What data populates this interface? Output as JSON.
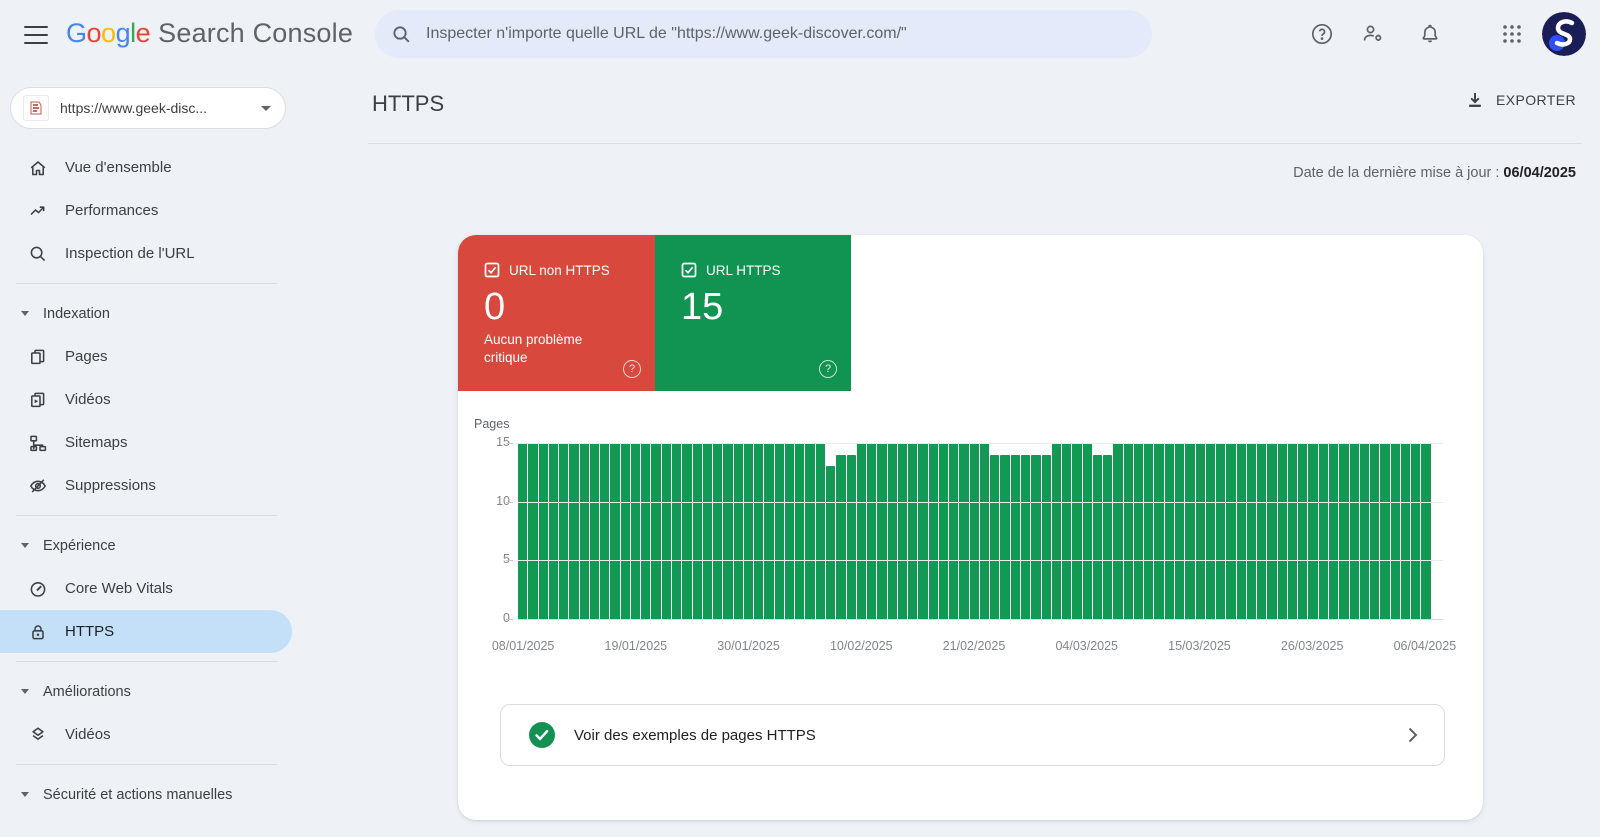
{
  "topbar": {
    "logo_letters": [
      {
        "ch": "G",
        "color": "#4285f4"
      },
      {
        "ch": "o",
        "color": "#ea4335"
      },
      {
        "ch": "o",
        "color": "#fbbc05"
      },
      {
        "ch": "g",
        "color": "#4285f4"
      },
      {
        "ch": "l",
        "color": "#34a853"
      },
      {
        "ch": "e",
        "color": "#ea4335"
      }
    ],
    "logo_suffix": "Search Console",
    "search_placeholder": "Inspecter n'importe quelle URL de \"https://www.geek-discover.com/\""
  },
  "property": {
    "name": "https://www.geek-disc..."
  },
  "sidebar": {
    "items": [
      {
        "type": "item",
        "id": "overview",
        "icon": "home",
        "label": "Vue d'ensemble"
      },
      {
        "type": "item",
        "id": "performances",
        "icon": "performance",
        "label": "Performances"
      },
      {
        "type": "item",
        "id": "url-inspection",
        "icon": "inspect",
        "label": "Inspection de l'URL"
      },
      {
        "type": "divider"
      },
      {
        "type": "section",
        "id": "indexation",
        "label": "Indexation"
      },
      {
        "type": "item",
        "id": "pages",
        "icon": "pages",
        "label": "Pages"
      },
      {
        "type": "item",
        "id": "videos-indexation",
        "icon": "videos",
        "label": "Vidéos"
      },
      {
        "type": "item",
        "id": "sitemaps",
        "icon": "sitemaps",
        "label": "Sitemaps"
      },
      {
        "type": "item",
        "id": "removals",
        "icon": "eye-off",
        "label": "Suppressions"
      },
      {
        "type": "divider"
      },
      {
        "type": "section",
        "id": "experience",
        "label": "Expérience"
      },
      {
        "type": "item",
        "id": "core-web-vitals",
        "icon": "gauge",
        "label": "Core Web Vitals"
      },
      {
        "type": "item",
        "id": "https",
        "icon": "lock",
        "label": "HTTPS",
        "selected": true
      },
      {
        "type": "divider"
      },
      {
        "type": "section",
        "id": "enhancements",
        "label": "Améliorations"
      },
      {
        "type": "item",
        "id": "videos-enhancement",
        "icon": "layers",
        "label": "Vidéos"
      },
      {
        "type": "divider"
      },
      {
        "type": "section",
        "id": "security",
        "label": "Sécurité et actions manuelles"
      }
    ]
  },
  "header": {
    "title": "HTTPS",
    "export_label": "EXPORTER",
    "last_update_label": "Date de la dernière mise à jour :",
    "last_update_date": "06/04/2025"
  },
  "cards": [
    {
      "label": "URL non HTTPS",
      "value": "0",
      "sublabel": "Aucun problème critique",
      "color": "#d8483c"
    },
    {
      "label": "URL HTTPS",
      "value": "15",
      "sublabel": "",
      "color": "#119452"
    }
  ],
  "chart_data": {
    "type": "bar",
    "title": "",
    "ylabel": "Pages",
    "ylim": [
      0,
      15
    ],
    "y_ticks": [
      0,
      5,
      10,
      15
    ],
    "grid": true,
    "bar_color": "#129a54",
    "date_range": {
      "start": "08/01/2025",
      "end": "06/04/2025"
    },
    "x_tick_labels": [
      "08/01/2025",
      "19/01/2025",
      "30/01/2025",
      "10/02/2025",
      "21/02/2025",
      "04/03/2025",
      "15/03/2025",
      "26/03/2025",
      "06/04/2025"
    ],
    "series_name": "URL HTTPS (Pages)",
    "values": [
      15,
      15,
      15,
      15,
      15,
      15,
      15,
      15,
      15,
      15,
      15,
      15,
      15,
      15,
      15,
      15,
      15,
      15,
      15,
      15,
      15,
      15,
      15,
      15,
      15,
      15,
      15,
      15,
      15,
      15,
      13,
      14,
      14,
      15,
      15,
      15,
      15,
      15,
      15,
      15,
      15,
      15,
      15,
      15,
      15,
      15,
      14,
      14,
      14,
      14,
      14,
      14,
      15,
      15,
      15,
      15,
      14,
      14,
      15,
      15,
      15,
      15,
      15,
      15,
      15,
      15,
      15,
      15,
      15,
      15,
      15,
      15,
      15,
      15,
      15,
      15,
      15,
      15,
      15,
      15,
      15,
      15,
      15,
      15,
      15,
      15,
      15,
      15,
      15
    ]
  },
  "examples": {
    "label": "Voir des exemples de pages HTTPS"
  }
}
